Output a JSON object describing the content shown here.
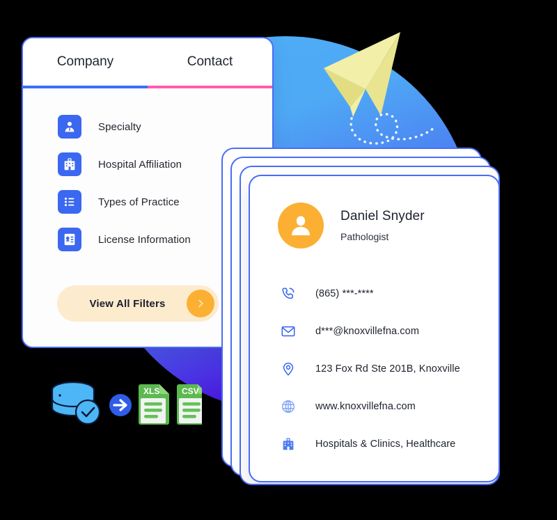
{
  "background": {
    "circle_gradient_from": "#4FAEF7",
    "circle_gradient_to": "#4E16D8",
    "plane_color": "#F2EFA8",
    "plane_icon": "paper-plane-icon",
    "trail_icon": "dotted-loop-trail-icon"
  },
  "filter_panel": {
    "tabs": [
      {
        "label": "Company",
        "underline_color": "#3B6FF5",
        "active": true
      },
      {
        "label": "Contact",
        "underline_color": "#FF5BB0",
        "active": false
      }
    ],
    "icon_bg": "#3B68F0",
    "items": [
      {
        "label": "Specialty",
        "icon": "doctor-avatar-icon"
      },
      {
        "label": "Hospital Affiliation",
        "icon": "hospital-building-icon"
      },
      {
        "label": "Types of Practice",
        "icon": "bullet-list-icon"
      },
      {
        "label": "License Information",
        "icon": "license-certificate-icon"
      }
    ],
    "view_all_button": {
      "label": "View All Filters",
      "bg": "#FDEBCE",
      "chevron_bg": "#FBB034",
      "chevron_icon": "chevron-right-icon"
    }
  },
  "export_row": {
    "database_icon": "database-check-icon",
    "arrow_icon": "arrow-right-circle-icon",
    "files": [
      {
        "label": "XLS",
        "icon": "xls-file-icon",
        "color": "#63C257"
      },
      {
        "label": "CSV",
        "icon": "csv-file-icon",
        "color": "#63C257"
      }
    ]
  },
  "contact_card": {
    "stack_count": 4,
    "border_color": "#4a6cf7",
    "avatar": {
      "icon": "user-avatar-icon",
      "bg": "#FBB034"
    },
    "name": "Daniel Snyder",
    "role": "Pathologist",
    "details": [
      {
        "icon": "phone-icon",
        "value": "(865) ***-****"
      },
      {
        "icon": "envelope-icon",
        "value": "d***@knoxvillefna.com"
      },
      {
        "icon": "location-pin-icon",
        "value": "123 Fox Rd Ste 201B, Knoxville"
      },
      {
        "icon": "globe-icon",
        "value": "www.knoxvillefna.com"
      },
      {
        "icon": "hospital-icon",
        "value": "Hospitals & Clinics, Healthcare"
      }
    ]
  }
}
